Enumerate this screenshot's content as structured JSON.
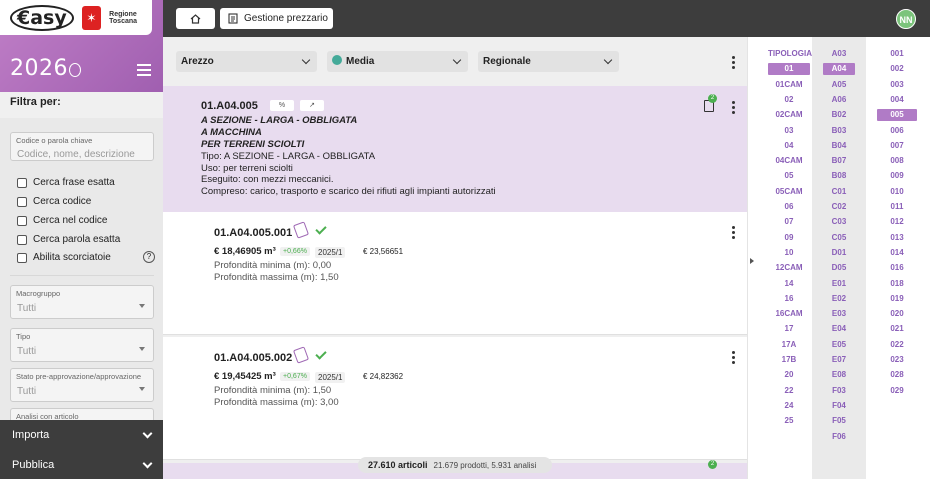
{
  "sidebar": {
    "brand": "€asy",
    "region": "Regione Toscana",
    "year": "2026",
    "filter_title": "Filtra per:",
    "search_label": "Codice o parola chiave",
    "search_placeholder": "Codice, nome, descrizione",
    "checkboxes": [
      "Cerca frase esatta",
      "Cerca codice",
      "Cerca nel codice",
      "Cerca parola esatta",
      "Abilita scorciatoie"
    ],
    "selects": [
      {
        "label": "Macrogruppo",
        "value": "Tutti"
      },
      {
        "label": "Tipo",
        "value": "Tutti"
      },
      {
        "label": "Stato pre-approvazione/approvazione",
        "value": "Tutti"
      },
      {
        "label": "Analisi con articolo",
        "value": ""
      }
    ],
    "footer": [
      "Importa",
      "Pubblica"
    ]
  },
  "topbar": {
    "price_button": "Gestione prezzario",
    "avatar": "NN"
  },
  "filters": {
    "province": "Arezzo",
    "price_type": "Media",
    "scope": "Regionale"
  },
  "header_item": {
    "code": "01.A04.005",
    "tag1": "%",
    "tag2": "↗",
    "badge": "2",
    "lines_bold": [
      "A SEZIONE - LARGA - OBBLIGATA",
      "A MACCHINA",
      "PER TERRENI SCIOLTI"
    ],
    "lines": [
      "Tipo: A SEZIONE - LARGA - OBBLIGATA",
      "Uso: per terreni sciolti",
      "Eseguito: con mezzi meccanici.",
      "Compreso: carico, trasporto e scarico dei rifiuti agli impianti autorizzati"
    ]
  },
  "items": [
    {
      "code": "01.A04.005.001",
      "price": "€ 18,46905 m³",
      "pct": "+0,66%",
      "version": "2025/1",
      "price2": "€ 23,56651",
      "props": [
        "Profondità minima (m): 0,00",
        "Profondità massima (m): 1,50"
      ]
    },
    {
      "code": "01.A04.005.002",
      "price": "€ 19,45425 m³",
      "pct": "+0,67%",
      "version": "2025/1",
      "price2": "€ 24,82362",
      "props": [
        "Profondità minima (m): 1,50",
        "Profondità massima (m): 3,00"
      ]
    }
  ],
  "next_badge": "2",
  "summary": {
    "count": "27.610 articoli",
    "detail": "21.679 prodotti, 5.931 analisi"
  },
  "index": {
    "col1": [
      "TIPOLOGIA",
      "01",
      "01CAM",
      "02",
      "02CAM",
      "03",
      "04",
      "04CAM",
      "05",
      "05CAM",
      "06",
      "07",
      "09",
      "10",
      "12CAM",
      "14",
      "16",
      "16CAM",
      "17",
      "17A",
      "17B",
      "20",
      "22",
      "24",
      "25"
    ],
    "col2": [
      "A03",
      "A04",
      "A05",
      "A06",
      "B02",
      "B03",
      "B04",
      "B07",
      "B08",
      "C01",
      "C02",
      "C03",
      "C05",
      "D01",
      "D05",
      "E01",
      "E02",
      "E03",
      "E04",
      "E05",
      "E07",
      "E08",
      "F03",
      "F04",
      "F05",
      "F06"
    ],
    "col3": [
      "001",
      "002",
      "003",
      "004",
      "005",
      "006",
      "007",
      "008",
      "009",
      "010",
      "011",
      "012",
      "013",
      "014",
      "016",
      "018",
      "019",
      "020",
      "021",
      "022",
      "023",
      "028",
      "029"
    ],
    "selected": {
      "col1": "01",
      "col2": "A04",
      "col3": "005"
    }
  }
}
